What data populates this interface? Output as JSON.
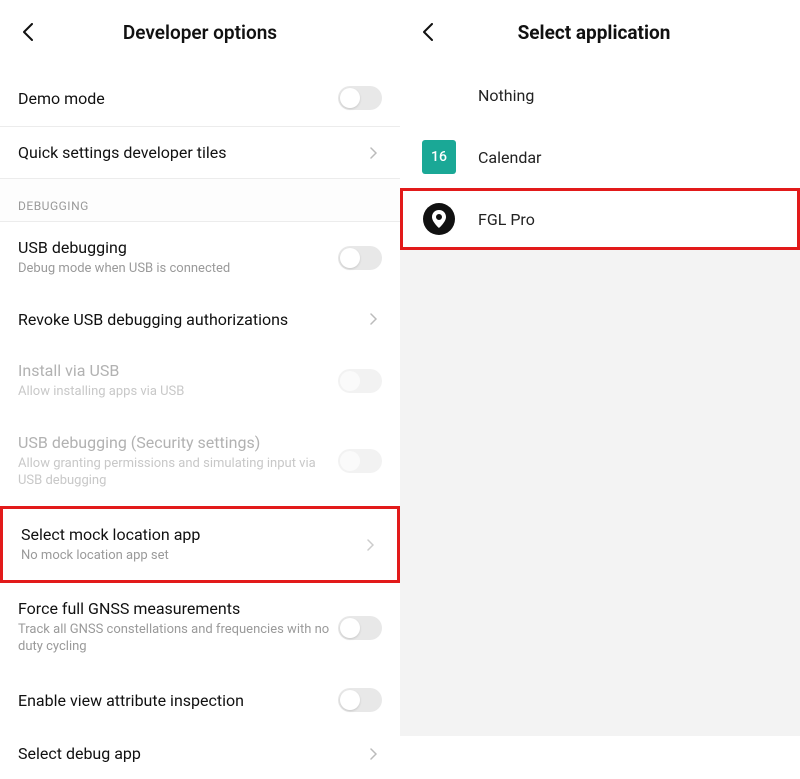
{
  "left": {
    "header_title": "Developer options",
    "rows": {
      "demo_mode": {
        "title": "Demo mode"
      },
      "quick_tiles": {
        "title": "Quick settings developer tiles"
      },
      "section_debugging": "DEBUGGING",
      "usb_debugging": {
        "title": "USB debugging",
        "sub": "Debug mode when USB is connected"
      },
      "revoke": {
        "title": "Revoke USB debugging authorizations"
      },
      "install_usb": {
        "title": "Install via USB",
        "sub": "Allow installing apps via USB"
      },
      "usb_sec": {
        "title": "USB debugging (Security settings)",
        "sub": "Allow granting permissions and simulating input via USB debugging"
      },
      "mock_loc": {
        "title": "Select mock location app",
        "sub": "No mock location app set"
      },
      "gnss": {
        "title": "Force full GNSS measurements",
        "sub": "Track all GNSS constellations and frequencies with no duty cycling"
      },
      "view_attr": {
        "title": "Enable view attribute inspection"
      },
      "debug_app": {
        "title": "Select debug app"
      }
    }
  },
  "right": {
    "header_title": "Select application",
    "items": {
      "nothing": "Nothing",
      "calendar": "Calendar",
      "cal_day": "16",
      "fgl": "FGL Pro"
    }
  }
}
